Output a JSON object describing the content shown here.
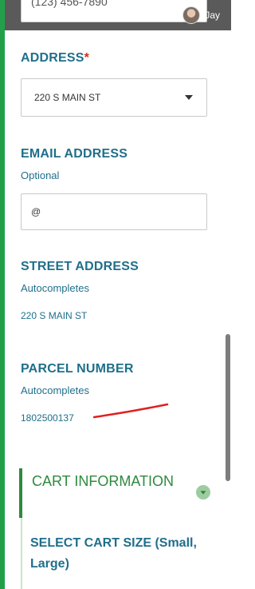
{
  "header": {
    "phone_value": "(123) 456-7890",
    "user_name": "Jay"
  },
  "address": {
    "label": "ADDRESS",
    "required_mark": "*",
    "selected_value": "220 S MAIN ST"
  },
  "email": {
    "label": "EMAIL ADDRESS",
    "hint": "Optional",
    "value": "@"
  },
  "street": {
    "label": "STREET ADDRESS",
    "hint": "Autocompletes",
    "value": "220 S MAIN ST"
  },
  "parcel": {
    "label": "PARCEL NUMBER",
    "hint": "Autocompletes",
    "value": "1802500137"
  },
  "cart": {
    "title": "CART INFORMATION",
    "size_label": "SELECT CART SIZE (Small, Large)"
  },
  "colors": {
    "accent_blue": "#1f6f8b",
    "accent_green": "#2d8a3e",
    "required_red": "#d52b1e",
    "annotation_red": "#e02020"
  }
}
